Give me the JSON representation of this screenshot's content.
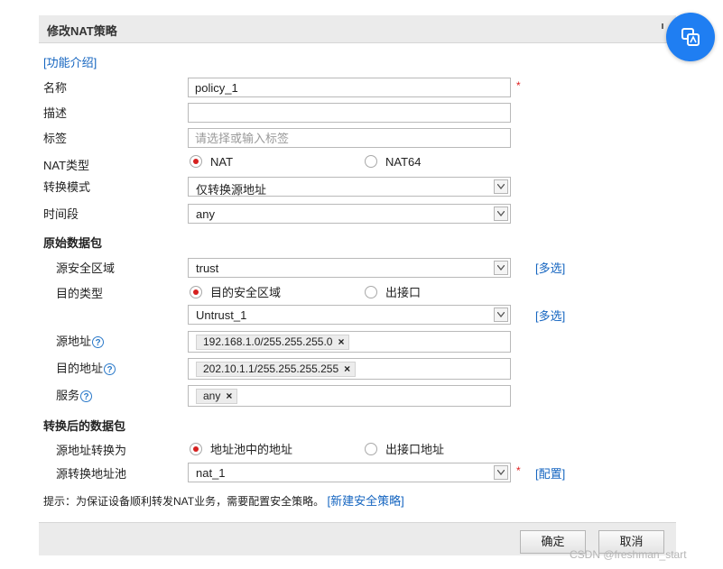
{
  "dialog": {
    "title": "修改NAT策略",
    "intro_link": "[功能介绍]"
  },
  "form": {
    "name": {
      "label": "名称",
      "value": "policy_1",
      "required": "*"
    },
    "description": {
      "label": "描述",
      "value": ""
    },
    "tags": {
      "label": "标签",
      "placeholder": "请选择或输入标签"
    },
    "nat_type": {
      "label": "NAT类型",
      "options": [
        "NAT",
        "NAT64"
      ],
      "selected": "NAT"
    },
    "convert_mode": {
      "label": "转换模式",
      "value": "仅转换源地址"
    },
    "time_range": {
      "label": "时间段",
      "value": "any"
    }
  },
  "original_packet": {
    "heading": "原始数据包",
    "src_zone": {
      "label": "源安全区域",
      "value": "trust",
      "multi_link": "[多选]"
    },
    "dst_type": {
      "label": "目的类型",
      "options": [
        "目的安全区域",
        "出接口"
      ],
      "selected": "目的安全区域"
    },
    "dst_zone": {
      "value": "Untrust_1",
      "multi_link": "[多选]"
    },
    "src_address": {
      "label": "源地址",
      "help": "?",
      "tags": [
        "192.168.1.0/255.255.255.0"
      ]
    },
    "dst_address": {
      "label": "目的地址",
      "help": "?",
      "tags": [
        "202.10.1.1/255.255.255.255"
      ]
    },
    "service": {
      "label": "服务",
      "help": "?",
      "tags": [
        "any"
      ]
    }
  },
  "converted_packet": {
    "heading": "转换后的数据包",
    "src_convert_to": {
      "label": "源地址转换为",
      "options": [
        "地址池中的地址",
        "出接口地址"
      ],
      "selected": "地址池中的地址"
    },
    "src_pool": {
      "label": "源转换地址池",
      "value": "nat_1",
      "required": "*",
      "config_link": "[配置]"
    }
  },
  "hint": {
    "text": "提示：为保证设备顺利转发NAT业务，需要配置安全策略。",
    "link": "[新建安全策略]"
  },
  "footer": {
    "ok_label": "确定",
    "cancel_label": "取消"
  },
  "tag_remove_symbol": "×",
  "watermark": "CSDN @freshman_start",
  "colors": {
    "accent_link": "#1565c0",
    "required": "#e02020",
    "radio_on": "#d6201f",
    "fab": "#1f7ef2"
  }
}
